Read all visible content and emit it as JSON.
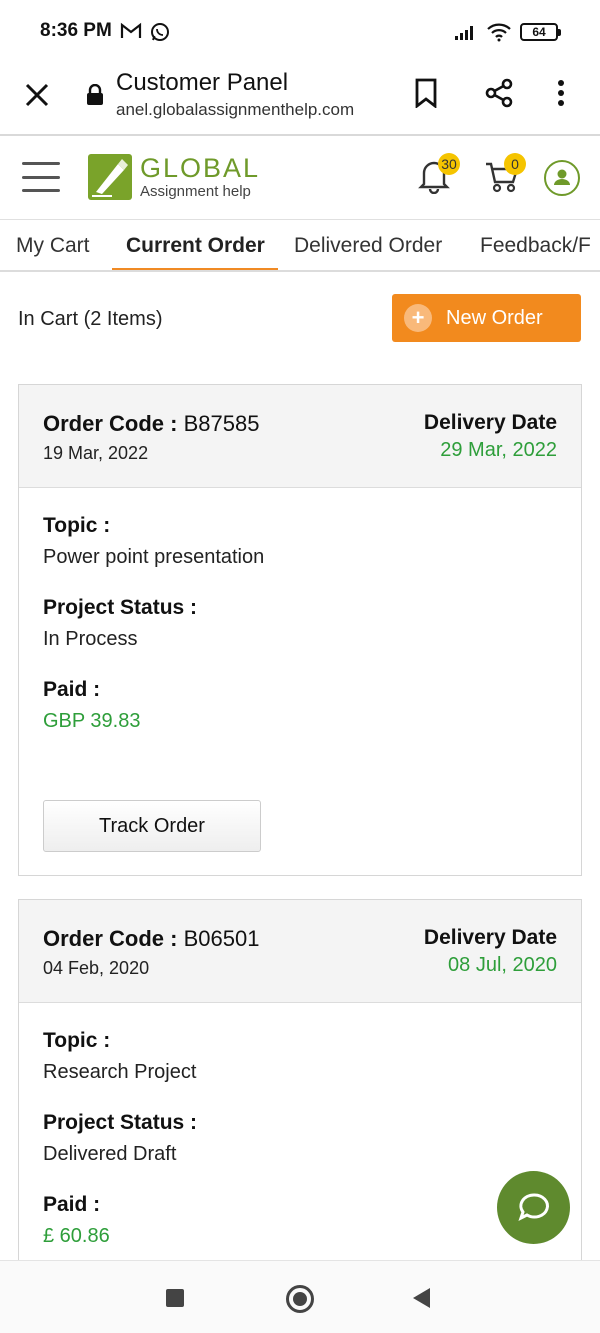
{
  "status_bar": {
    "time": "8:36 PM",
    "battery": "64",
    "left_icons": [
      "gmail-icon",
      "whatsapp-icon"
    ],
    "right_icons": [
      "signal-icon",
      "wifi-icon",
      "battery-icon"
    ]
  },
  "browser": {
    "title": "Customer Panel",
    "url": "anel.globalassignmenthelp.com",
    "icons": [
      "close-icon",
      "lock-icon",
      "bookmark-icon",
      "share-icon",
      "more-vert-icon"
    ]
  },
  "header": {
    "logo_title": "GLOBAL",
    "logo_subtitle": "Assignment help",
    "notifications_count": "30",
    "cart_count": "0",
    "icons": [
      "menu-icon",
      "bell-icon",
      "cart-icon",
      "user-icon"
    ]
  },
  "tabs": [
    {
      "label": "My Cart",
      "active": false
    },
    {
      "label": "Current Order",
      "active": true
    },
    {
      "label": "Delivered Order",
      "active": false
    },
    {
      "label": "Feedback/F",
      "active": false
    }
  ],
  "cart_summary": {
    "in_cart_text": "In Cart (2 Items)",
    "new_order_label": "New Order"
  },
  "orders": [
    {
      "code_label": "Order Code :",
      "code": "B87585",
      "order_date": "19 Mar, 2022",
      "delivery_label": "Delivery Date",
      "delivery_date": "29 Mar, 2022",
      "topic_label": "Topic :",
      "topic": "Power point presentation",
      "status_label": "Project Status :",
      "status": "In Process",
      "paid_label": "Paid :",
      "paid": "GBP 39.83",
      "track_label": "Track Order"
    },
    {
      "code_label": "Order Code :",
      "code": "B06501",
      "order_date": "04 Feb, 2020",
      "delivery_label": "Delivery Date",
      "delivery_date": "08 Jul, 2020",
      "topic_label": "Topic :",
      "topic": "Research Project",
      "status_label": "Project Status :",
      "status": "Delivered Draft",
      "paid_label": "Paid :",
      "paid": "£ 60.86"
    }
  ],
  "colors": {
    "accent_orange": "#f28a1e",
    "brand_green": "#6f9a2a",
    "date_green": "#2e9e3a",
    "badge_yellow": "#f5c400"
  },
  "nav_bar": {
    "icons": [
      "recents-icon",
      "home-icon",
      "back-icon"
    ]
  }
}
